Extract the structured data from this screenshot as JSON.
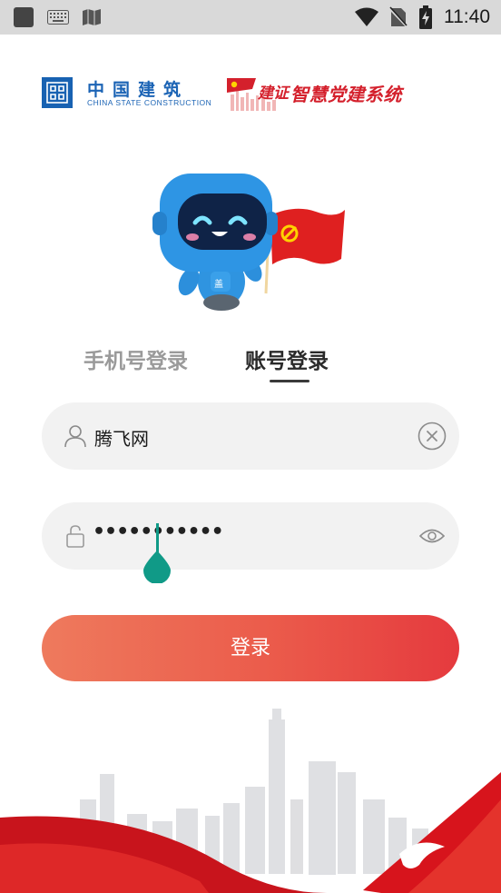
{
  "status_bar": {
    "time": "11:40"
  },
  "brand": {
    "company_cn": "中国建筑",
    "company_en": "CHINA STATE CONSTRUCTION",
    "logo_text": "建证",
    "system_name": "智慧党建系统"
  },
  "tabs": [
    {
      "label": "手机号登录",
      "active": false
    },
    {
      "label": "账号登录",
      "active": true
    }
  ],
  "username": {
    "value": "腾飞网",
    "icon": "user-icon",
    "clear_icon": "clear-circle-icon"
  },
  "password": {
    "value": "•••••••••••",
    "icon": "lock-icon",
    "toggle_icon": "eye-icon"
  },
  "login_button": {
    "label": "登录"
  },
  "colors": {
    "accent_red": "#e53a3e",
    "button_gradient_start": "#ee7a5d",
    "cscec_blue": "#1c64b5",
    "cursor_teal": "#109a87"
  }
}
